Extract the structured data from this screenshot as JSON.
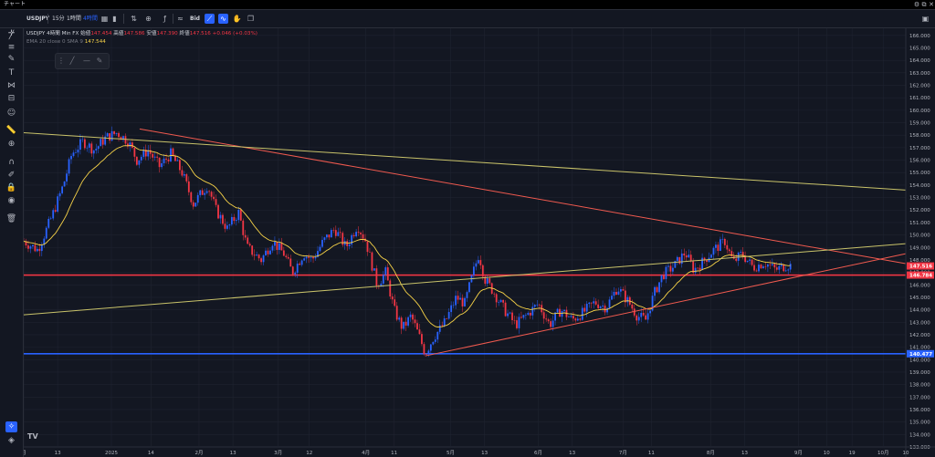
{
  "window": {
    "title": "チャート"
  },
  "toolbar": {
    "symbol": "USDJPY",
    "intervals": [
      "15分",
      "1時間",
      "4時間"
    ],
    "bid_label": "Bid"
  },
  "legend": {
    "symbol": "USDJPY",
    "interval": "4時間",
    "source": "Min FX",
    "o_label": "始値",
    "o": "147.454",
    "h_label": "高値",
    "h": "147.586",
    "l_label": "安値",
    "l": "147.390",
    "c_label": "終値",
    "c": "147.516",
    "change": "+0.046 (+0.03%)",
    "ema_label": "EMA 20 close 0 SMA 9",
    "ema_value": "147.544"
  },
  "colors": {
    "bg": "#131722",
    "up": "#2962ff",
    "down": "#f23645",
    "ema": "#f7d348",
    "trend_red": "#f05a4f",
    "trend_yellow": "#c9c36a",
    "support_blue": "#2962ff",
    "hline_red": "#f23645"
  },
  "chart_data": {
    "type": "candlestick",
    "symbol": "USDJPY",
    "interval": "4時間",
    "ylim": [
      133,
      166.5
    ],
    "y_ticks": [
      "166.000",
      "165.000",
      "164.000",
      "163.000",
      "162.000",
      "161.000",
      "160.000",
      "159.000",
      "158.000",
      "157.000",
      "156.000",
      "155.000",
      "154.000",
      "153.000",
      "152.000",
      "151.000",
      "150.000",
      "149.000",
      "148.000",
      "147.000",
      "146.000",
      "145.000",
      "144.000",
      "143.000",
      "142.000",
      "141.000",
      "140.000",
      "139.000",
      "138.000",
      "137.000",
      "136.000",
      "135.000",
      "134.000",
      "133.000"
    ],
    "x_ticks": [
      "月",
      "13",
      "2025",
      "14",
      "2月",
      "13",
      "3月",
      "12",
      "4月",
      "11",
      "5月",
      "13",
      "6月",
      "13",
      "7月",
      "11",
      "8月",
      "13",
      "9月",
      "10",
      "19",
      "10月",
      "10"
    ],
    "x_range_days": [
      0,
      312
    ],
    "tick_days": [
      0,
      12,
      31,
      45,
      62,
      74,
      90,
      101,
      121,
      131,
      151,
      163,
      182,
      194,
      212,
      222,
      243,
      255,
      274,
      284,
      293,
      304,
      312
    ],
    "price_path": [
      [
        0,
        149.5
      ],
      [
        5,
        148.8
      ],
      [
        10,
        151.5
      ],
      [
        14,
        154.0
      ],
      [
        17,
        156.5
      ],
      [
        21,
        157.5
      ],
      [
        25,
        156.8
      ],
      [
        29,
        157.8
      ],
      [
        33,
        158.2
      ],
      [
        37,
        157.5
      ],
      [
        40,
        156.0
      ],
      [
        44,
        156.8
      ],
      [
        48,
        155.5
      ],
      [
        52,
        156.5
      ],
      [
        56,
        155.0
      ],
      [
        60,
        152.5
      ],
      [
        65,
        154.0
      ],
      [
        68,
        152.0
      ],
      [
        72,
        150.5
      ],
      [
        76,
        151.8
      ],
      [
        79,
        149.0
      ],
      [
        84,
        148.0
      ],
      [
        88,
        149.5
      ],
      [
        92,
        148.5
      ],
      [
        95,
        147.0
      ],
      [
        99,
        148.5
      ],
      [
        102,
        148.0
      ],
      [
        106,
        149.5
      ],
      [
        110,
        150.5
      ],
      [
        114,
        149.0
      ],
      [
        118,
        150.8
      ],
      [
        121,
        149.5
      ],
      [
        125,
        146.0
      ],
      [
        128,
        147.0
      ],
      [
        131,
        144.0
      ],
      [
        134,
        142.5
      ],
      [
        137,
        143.5
      ],
      [
        140,
        141.8
      ],
      [
        142,
        140.5
      ],
      [
        145,
        141.8
      ],
      [
        149,
        143.0
      ],
      [
        153,
        145.0
      ],
      [
        156,
        144.5
      ],
      [
        159,
        147.0
      ],
      [
        161,
        148.5
      ],
      [
        163,
        146.5
      ],
      [
        166,
        145.5
      ],
      [
        170,
        144.0
      ],
      [
        174,
        142.8
      ],
      [
        178,
        143.6
      ],
      [
        182,
        144.5
      ],
      [
        186,
        142.8
      ],
      [
        190,
        144.0
      ],
      [
        194,
        143.2
      ],
      [
        198,
        143.8
      ],
      [
        202,
        144.6
      ],
      [
        206,
        144.2
      ],
      [
        210,
        145.8
      ],
      [
        214,
        144.6
      ],
      [
        217,
        143.5
      ],
      [
        220,
        143.2
      ],
      [
        223,
        145.3
      ],
      [
        226,
        146.8
      ],
      [
        230,
        147.5
      ],
      [
        234,
        148.6
      ],
      [
        237,
        147.2
      ],
      [
        240,
        147.8
      ],
      [
        244,
        148.8
      ],
      [
        248,
        149.5
      ],
      [
        251,
        147.8
      ],
      [
        254,
        148.5
      ],
      [
        258,
        147.4
      ],
      [
        262,
        147.8
      ],
      [
        266,
        147.2
      ],
      [
        270,
        147.6
      ],
      [
        272,
        147.5
      ]
    ],
    "ema_series": {
      "name": "EMA 20 close 0 SMA 9",
      "last_value": 147.544
    },
    "last_price": 147.516,
    "horizontal_lines": [
      {
        "price": 146.784,
        "color": "#f23645"
      },
      {
        "price": 140.477,
        "color": "#2962ff"
      }
    ],
    "trendlines": [
      {
        "color": "#f05a4f",
        "from": [
          41,
          158.5
        ],
        "to": [
          312,
          147.7
        ]
      },
      {
        "color": "#f05a4f",
        "from": [
          142,
          140.3
        ],
        "to": [
          312,
          148.5
        ]
      },
      {
        "color": "#c9c36a",
        "from": [
          0,
          158.2
        ],
        "to": [
          312,
          153.6
        ]
      },
      {
        "color": "#c9c36a",
        "from": [
          0,
          143.6
        ],
        "to": [
          312,
          149.3
        ]
      }
    ],
    "price_labels": [
      "147.516",
      "146.784",
      "140.477"
    ]
  }
}
